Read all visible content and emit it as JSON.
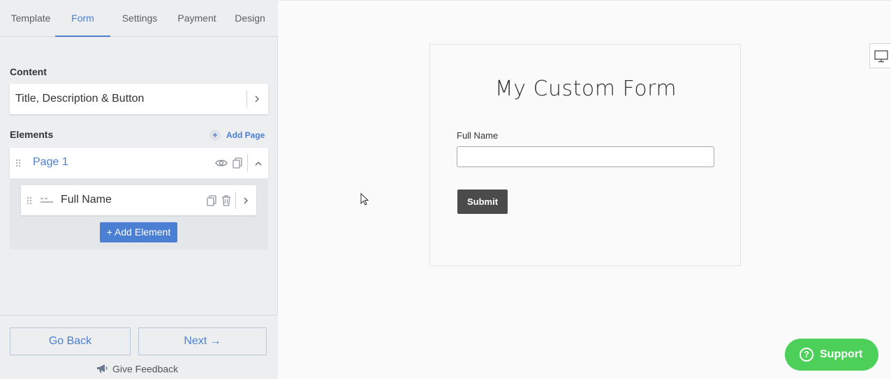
{
  "tabs": [
    "Template",
    "Form",
    "Settings",
    "Payment",
    "Design"
  ],
  "active_tab": "Form",
  "sidebar": {
    "content_label": "Content",
    "content_value": "Title, Description & Button",
    "elements_label": "Elements",
    "add_page_label": "Add Page",
    "page_title": "Page 1",
    "element_title": "Full Name",
    "add_element_label": "+ Add Element"
  },
  "footer": {
    "back_label": "Go Back",
    "next_label": "Next →",
    "feedback_label": "Give Feedback"
  },
  "form": {
    "title": "My Custom Form",
    "field_label": "Full Name",
    "field_value": "",
    "submit_label": "Submit"
  },
  "support_label": "Support",
  "colors": {
    "accent": "#4a7fd4",
    "submit": "#4b4b4b",
    "support": "#4cd05a"
  }
}
